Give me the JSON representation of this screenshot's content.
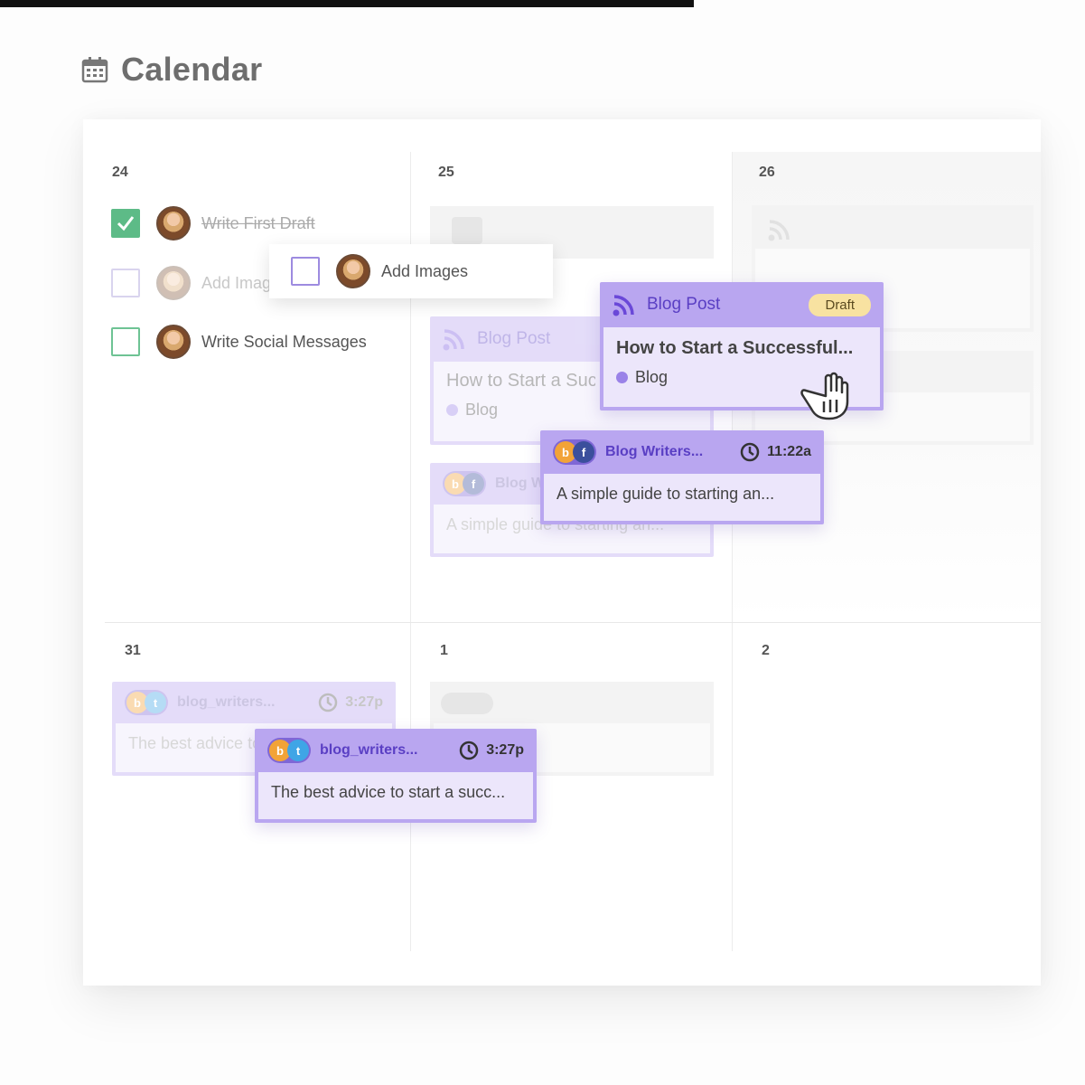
{
  "header": {
    "title": "Calendar",
    "icon": "calendar-icon"
  },
  "days": {
    "d24": "24",
    "d25": "25",
    "d26": "26",
    "d31": "31",
    "d1": "1",
    "d2": "2"
  },
  "tasks": {
    "first_draft": "Write First Draft",
    "add_images_faded": "Add Images",
    "social_messages": "Write Social Messages",
    "add_images_drag": "Add Images"
  },
  "blog_card": {
    "type_label": "Blog Post",
    "status": "Draft",
    "title": "How to Start a Successful...",
    "category": "Blog",
    "ghost_title": "How to Start a Successful...",
    "ghost_category": "Blog"
  },
  "social_fb_card": {
    "account": "Blog Writers...",
    "time": "11:22a",
    "text": "A simple guide to starting an...",
    "ghost_account": "Blog Writers...",
    "ghost_text": "A simple guide to starting an..."
  },
  "social_tw_card": {
    "account": "blog_writers...",
    "time": "3:27p",
    "text": "The best advice to start a succ...",
    "ghost_account": "blog_writers...",
    "ghost_time": "3:27p",
    "ghost_text": "The best advice to start a succ..."
  },
  "colors": {
    "accent_purple": "#b9a6f0",
    "card_body": "#ece6fb",
    "check_green": "#5dbb87",
    "draft_badge": "#f8e2a1"
  }
}
